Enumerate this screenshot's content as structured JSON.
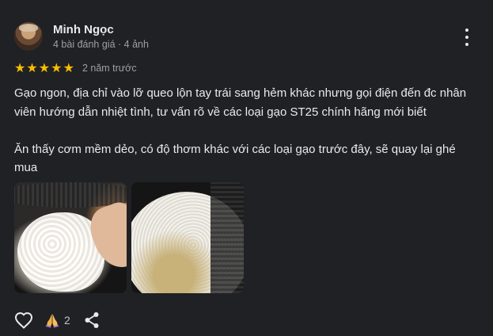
{
  "reviewer": {
    "name": "Minh Ngọc",
    "stats": "4 bài đánh giá · 4 ảnh"
  },
  "rating": {
    "stars": 5,
    "max_stars": 5,
    "star_glyph": "★",
    "date": "2 năm trước"
  },
  "review": {
    "paragraph_1": "Gạo ngon, địa chỉ vào lỡ queo lộn tay trái sang hẻm khác nhưng gọi điện đến đc nhân viên hướng dẫn nhiệt tình, tư vấn rõ về các loại gạo ST25 chính hãng mới biết",
    "paragraph_2": "Ăn thấy cơm mềm dẻo, có độ thơm khác với các loại gạo trước đây, sẽ quay lại ghé mua"
  },
  "actions": {
    "reaction_count": "2",
    "icons": [
      "heart-outline-icon",
      "folded-hands-icon",
      "share-icon",
      "more-vert-icon"
    ]
  },
  "colors": {
    "background": "#202124",
    "star": "#fbbc04",
    "primary_text": "#e8eaed",
    "secondary_text": "#9aa0a6"
  }
}
